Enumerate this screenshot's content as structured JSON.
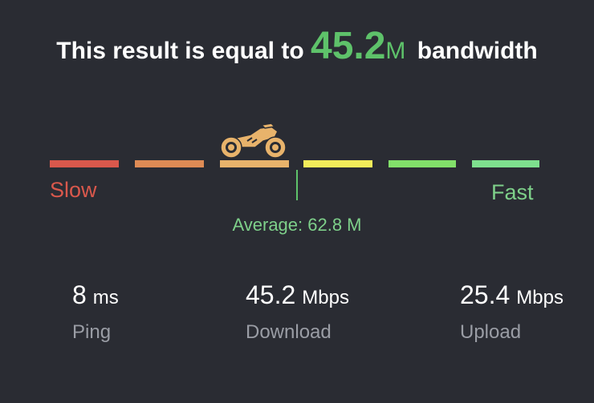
{
  "result": {
    "prefix": "This result is equal to",
    "value": "45.2",
    "unit": "M",
    "suffix": "bandwidth",
    "value_color": "#5ec26a"
  },
  "speed_scale": {
    "segment_colors": [
      "#d9584c",
      "#de8b55",
      "#e8b36b",
      "#f2ec5a",
      "#82e06a",
      "#7ee08e"
    ],
    "current_segment_index": 2,
    "min_label": "Slow",
    "max_label": "Fast",
    "min_label_color": "#d9584c",
    "max_label_color": "#7ed08a",
    "indicator_icon": "motorcycle-icon",
    "average_text": "Average: 62.8 M"
  },
  "stats": [
    {
      "value": "8",
      "unit": "ms",
      "label": "Ping"
    },
    {
      "value": "45.2",
      "unit": "Mbps",
      "label": "Download"
    },
    {
      "value": "25.4",
      "unit": "Mbps",
      "label": "Upload"
    }
  ]
}
